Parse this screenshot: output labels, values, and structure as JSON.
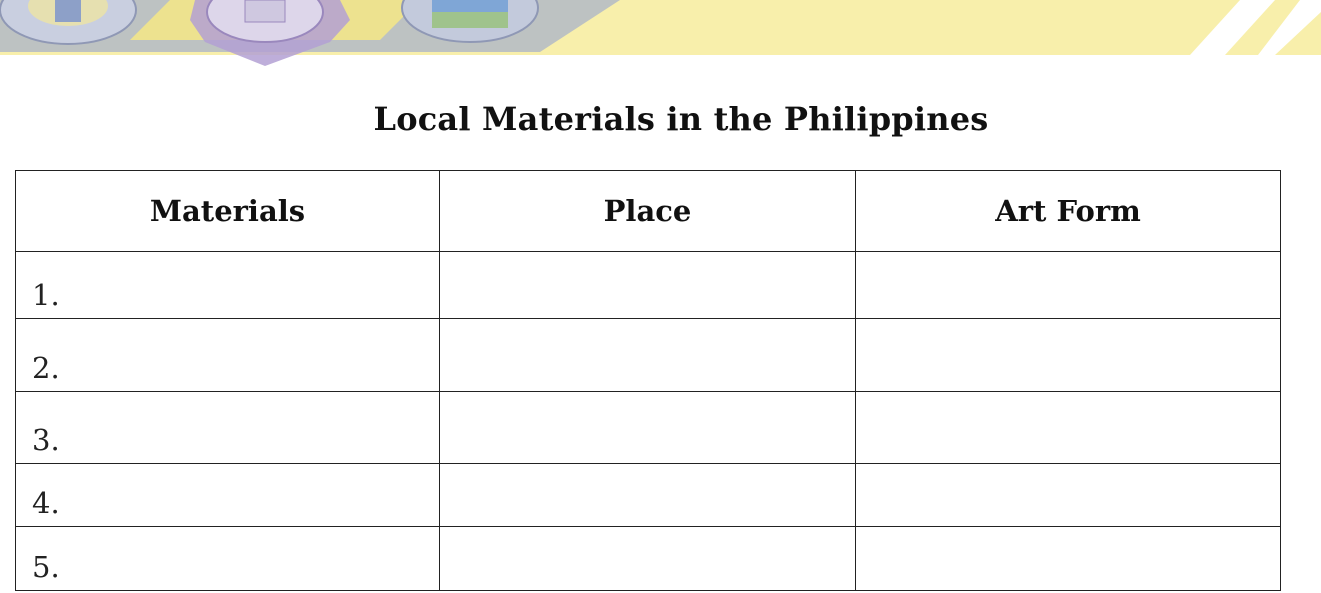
{
  "document": {
    "title": "Local Materials in the Philippines"
  },
  "banner": {
    "colors": {
      "yellow": "#f7ec9c",
      "gray_blue": "#a9b3c9",
      "purple": "#b3a0d3",
      "white_stripe": "#ffffff"
    },
    "icons": [
      "school-seal-icon",
      "emblem-seal-icon",
      "division-seal-icon"
    ]
  },
  "table": {
    "headers": [
      "Materials",
      "Place",
      "Art Form"
    ],
    "rows": [
      {
        "number": "1.",
        "place": "",
        "art_form": ""
      },
      {
        "number": "2.",
        "place": "",
        "art_form": ""
      },
      {
        "number": "3.",
        "place": "",
        "art_form": ""
      },
      {
        "number": "4.",
        "place": "",
        "art_form": ""
      },
      {
        "number": "5.",
        "place": "",
        "art_form": ""
      }
    ]
  }
}
